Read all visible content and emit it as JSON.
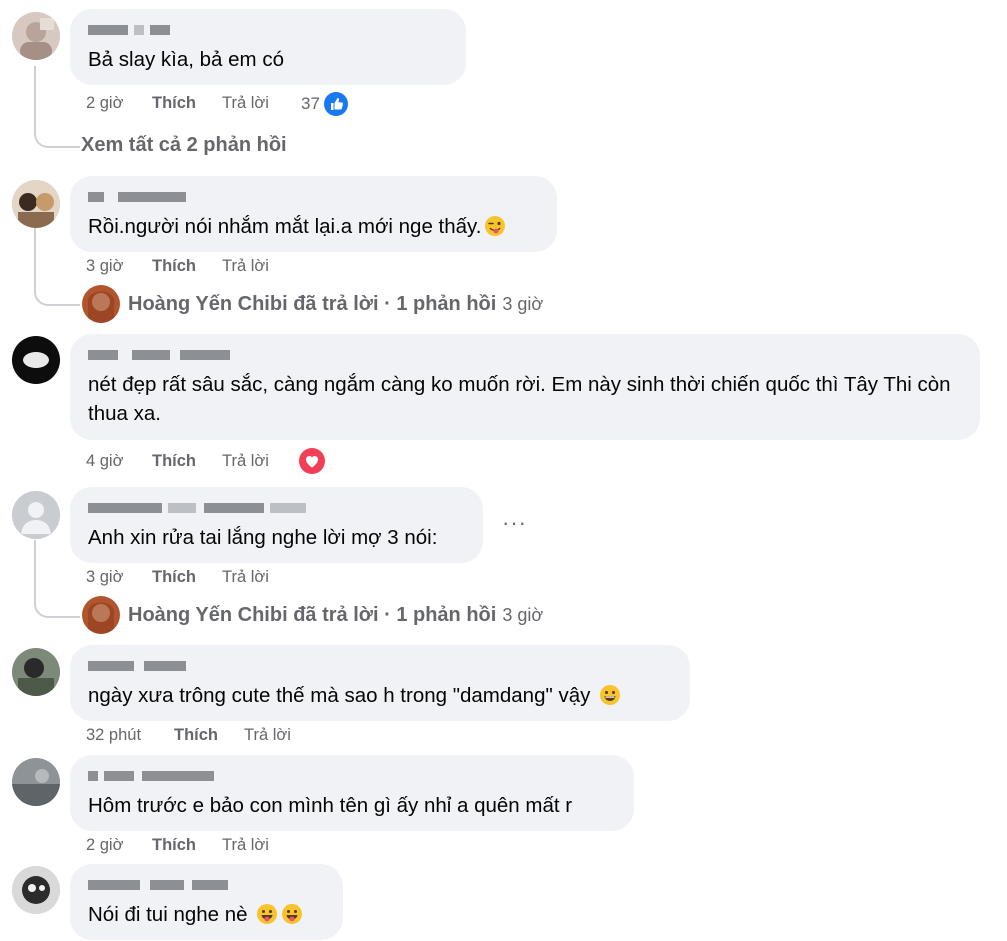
{
  "colors": {
    "bubble": "#f0f2f5",
    "meta": "#65676b",
    "like_blue": "#1877f2",
    "love_red": "#f33e58"
  },
  "comments": [
    {
      "name": "",
      "text": "Bả slay kìa,                    bả em có",
      "time": "2 giờ",
      "like": "Thích",
      "reply": "Trả lời",
      "reactions": "37",
      "reaction_icon": "like-icon"
    },
    {
      "name": "",
      "text": "Rồi.người nói nhắm mắt lại.a mới nge thấy.",
      "time": "3 giờ",
      "like": "Thích",
      "reply": "Trả lời",
      "emoji": "winking-tongue-emoji"
    },
    {
      "name": "",
      "text": "nét đẹp rất sâu sắc, càng ngắm càng ko muốn rời. Em này sinh thời chiến quốc thì Tây Thi còn thua xa.",
      "time": "4 giờ",
      "like": "Thích",
      "reply": "Trả lời",
      "reaction_icon": "love-icon"
    },
    {
      "name": "",
      "text": "Anh xin rửa tai lắng nghe lời mợ 3 nói:",
      "time": "3 giờ",
      "like": "Thích",
      "reply": "Trả lời",
      "more": "···"
    },
    {
      "name": "",
      "text": "ngày xưa trông cute thế mà sao h trong \"damdang\" vậy",
      "time": "32 phút",
      "like": "Thích",
      "reply": "Trả lời",
      "emoji": "grinning-emoji"
    },
    {
      "name": "",
      "text": "Hôm trước e bảo con mình tên gì ấy nhỉ a quên mất r",
      "time": "2 giờ",
      "like": "Thích",
      "reply": "Trả lời"
    },
    {
      "name": "",
      "text": "Nói đi tui nghe nè",
      "time": "",
      "like": "",
      "reply": "",
      "emoji": "tongue-emoji"
    }
  ],
  "view_all_replies": "Xem tất cả 2 phản hồi",
  "reply_summaries": [
    {
      "text": "Hoàng Yến Chibi đã trả lời · 1 phản hồi",
      "ago": "3 giờ"
    },
    {
      "text": "Hoàng Yến Chibi đã trả lời · 1 phản hồi",
      "ago": "3 giờ"
    }
  ]
}
